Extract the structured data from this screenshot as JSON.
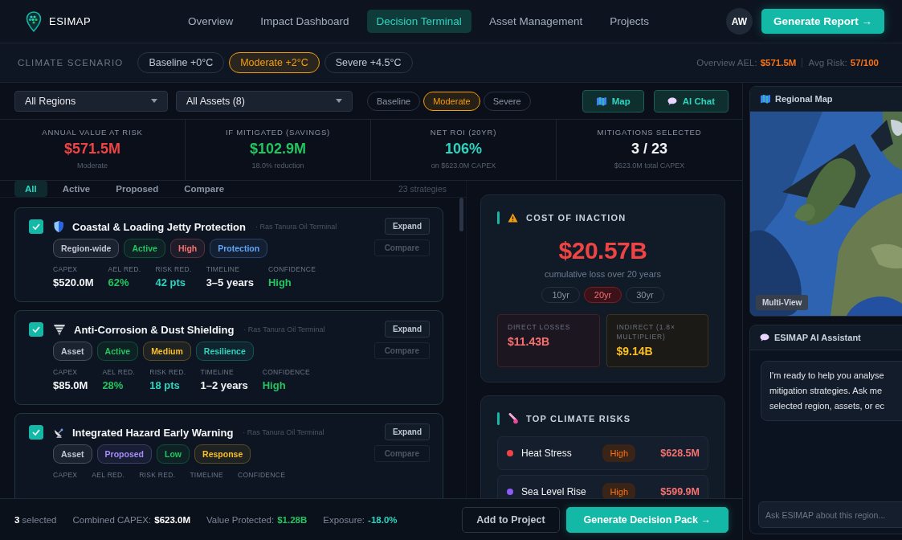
{
  "header": {
    "brand": "ESIMAP",
    "nav": [
      {
        "label": "Overview",
        "selected": false
      },
      {
        "label": "Impact Dashboard",
        "selected": false
      },
      {
        "label": "Decision Terminal",
        "selected": true
      },
      {
        "label": "Asset Management",
        "selected": false
      },
      {
        "label": "Projects",
        "selected": false
      }
    ],
    "avatar": "AW",
    "report_button": "Generate Report →"
  },
  "scenario_bar": {
    "label": "CLIMATE SCENARIO",
    "scenarios": [
      {
        "label": "Baseline +0°C",
        "selected": false
      },
      {
        "label": "Moderate +2°C",
        "selected": true
      },
      {
        "label": "Severe +4.5°C",
        "selected": false
      }
    ],
    "summary": [
      {
        "label": "Overview AEL:",
        "value": "$571.5M"
      },
      {
        "label": "Avg Risk:",
        "value": "57/100"
      }
    ]
  },
  "filters": {
    "selects": [
      {
        "value": "All Regions"
      },
      {
        "value": "All Assets (8)"
      }
    ],
    "scenarios": [
      {
        "label": "Baseline",
        "selected": false
      },
      {
        "label": "Moderate",
        "selected": true
      },
      {
        "label": "Severe",
        "selected": false
      }
    ],
    "buttons": [
      {
        "label": "Map",
        "kind": "map"
      },
      {
        "label": "AI Chat",
        "kind": "chat"
      }
    ]
  },
  "kpis": [
    {
      "label": "ANNUAL VALUE AT RISK",
      "value": "$571.5M",
      "note": "Moderate",
      "color": "#ef4444"
    },
    {
      "label": "IF MITIGATED (SAVINGS)",
      "value": "$102.9M",
      "note": "18.0% reduction",
      "color": "#22c55e"
    },
    {
      "label": "NET ROI (20YR)",
      "value": "106%",
      "note": "on $623.0M CAPEX",
      "color": "#2dd4bf"
    },
    {
      "label": "MITIGATIONS SELECTED",
      "value": "3 / 23",
      "note": "$623.0M total CAPEX",
      "color": "#f3f4f6"
    }
  ],
  "strategies": {
    "tabs": [
      {
        "label": "All",
        "selected": true
      },
      {
        "label": "Active",
        "selected": false
      },
      {
        "label": "Proposed",
        "selected": false
      },
      {
        "label": "Compare",
        "selected": false
      }
    ],
    "count": "23 strategies",
    "items": [
      {
        "checked": true,
        "kind": "shield",
        "title": "Coastal & Loading Jetty Protection",
        "location": "· Ras Tanura Oil Terminal",
        "tags": [
          {
            "label": "Region-wide",
            "color": "#c0c7d2"
          },
          {
            "label": "Active",
            "color": "#22c55e"
          },
          {
            "label": "High",
            "color": "#f87171"
          },
          {
            "label": "Protection",
            "color": "#60a5fa"
          }
        ],
        "metrics": [
          {
            "label": "CAPEX",
            "value": "$520.0M",
            "color": "#f3f4f6"
          },
          {
            "label": "AEL RED.",
            "value": "62%",
            "color": "#22c55e"
          },
          {
            "label": "RISK RED.",
            "value": "42 pts",
            "color": "#2dd4bf"
          },
          {
            "label": "TIMELINE",
            "value": "3–5 years",
            "color": "#f3f4f6"
          },
          {
            "label": "CONFIDENCE",
            "value": "High",
            "color": "#22c55e"
          }
        ],
        "buttons": [
          "Expand",
          "Compare"
        ]
      },
      {
        "checked": true,
        "kind": "funnel",
        "title": "Anti-Corrosion & Dust Shielding",
        "location": "· Ras Tanura Oil Terminal",
        "tags": [
          {
            "label": "Asset",
            "color": "#c0c7d2"
          },
          {
            "label": "Active",
            "color": "#22c55e"
          },
          {
            "label": "Medium",
            "color": "#fbbf24"
          },
          {
            "label": "Resilience",
            "color": "#2dd4bf"
          }
        ],
        "metrics": [
          {
            "label": "CAPEX",
            "value": "$85.0M",
            "color": "#f3f4f6"
          },
          {
            "label": "AEL RED.",
            "value": "28%",
            "color": "#22c55e"
          },
          {
            "label": "RISK RED.",
            "value": "18 pts",
            "color": "#2dd4bf"
          },
          {
            "label": "TIMELINE",
            "value": "1–2 years",
            "color": "#f3f4f6"
          },
          {
            "label": "CONFIDENCE",
            "value": "High",
            "color": "#22c55e"
          }
        ],
        "buttons": [
          "Expand",
          "Compare"
        ]
      },
      {
        "checked": true,
        "kind": "dish",
        "title": "Integrated Hazard Early Warning",
        "location": "· Ras Tanura Oil Terminal",
        "tags": [
          {
            "label": "Asset",
            "color": "#c0c7d2"
          },
          {
            "label": "Proposed",
            "color": "#a78bfa"
          },
          {
            "label": "Low",
            "color": "#22c55e"
          },
          {
            "label": "Response",
            "color": "#fbbf24"
          }
        ],
        "metrics": [
          {
            "label": "CAPEX"
          },
          {
            "label": "AEL RED."
          },
          {
            "label": "RISK RED."
          },
          {
            "label": "TIMELINE"
          },
          {
            "label": "CONFIDENCE"
          }
        ],
        "buttons": [
          "Expand",
          "Compare"
        ]
      }
    ]
  },
  "cost_of_inaction": {
    "title": "COST OF INACTION",
    "value": "$20.57B",
    "caption": "cumulative loss over 20 years",
    "periods": [
      {
        "label": "10yr",
        "selected": false
      },
      {
        "label": "20yr",
        "selected": true
      },
      {
        "label": "30yr",
        "selected": false
      }
    ],
    "breakdown": [
      {
        "label": "DIRECT LOSSES",
        "value": "$11.43B",
        "kind": "direct"
      },
      {
        "label": "INDIRECT (1.8× MULTIPLIER)",
        "value": "$9.14B",
        "kind": "indirect"
      }
    ]
  },
  "top_risks": {
    "title": "TOP CLIMATE RISKS",
    "rows": [
      {
        "name": "Heat Stress",
        "level": "High",
        "value": "$628.5M",
        "color": "#ef4444"
      },
      {
        "name": "Sea Level Rise",
        "level": "High",
        "value": "$599.9M",
        "color": "#8b5cf6"
      }
    ]
  },
  "regional_map": {
    "title": "Regional Map",
    "badge": "Multi-View"
  },
  "assistant": {
    "title": "ESIMAP AI Assistant",
    "message_lines": [
      "I'm ready to help you analyse",
      "mitigation strategies. Ask me",
      "selected region, assets, or ec"
    ],
    "input": {
      "placeholder": "Ask ESIMAP about this region..."
    }
  },
  "footer": {
    "selected": "**3** selected",
    "stats": [
      {
        "label": "Combined CAPEX:",
        "value": "$623.0M",
        "color": "#ffffff"
      },
      {
        "label": "Value Protected:",
        "value": "$1.28B",
        "color": "#22c55e"
      },
      {
        "label": "Exposure:",
        "value": "-18.0%",
        "color": "#2dd4bf"
      }
    ],
    "buttons": [
      "Add to Project",
      "Generate Decision Pack →"
    ]
  }
}
